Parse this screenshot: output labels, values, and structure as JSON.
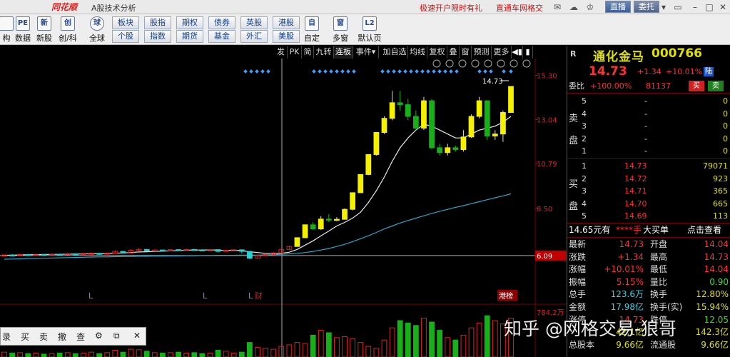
{
  "titlebar": {
    "logo": "同花顺",
    "title": "A股技术分析",
    "promo_1": "极速开户限时有礼",
    "promo_2": "直通车网格交",
    "live": "直播",
    "delegate": "委托"
  },
  "toolbar": {
    "big_left": [
      {
        "icon": "",
        "label": "构"
      },
      {
        "icon": "PE",
        "label": "数据"
      },
      {
        "icon": "新",
        "label": "新股"
      },
      {
        "icon": "创",
        "label": "创/科"
      },
      {
        "icon": "球",
        "label": "全球"
      }
    ],
    "grid_top": [
      "板块",
      "股指",
      "期权",
      "债券",
      "英股",
      "港股"
    ],
    "grid_bottom": [
      "个股",
      "指数",
      "期货",
      "基金",
      "外汇",
      "美股"
    ],
    "big_right": [
      {
        "icon": "自",
        "label": "自定"
      },
      {
        "icon": "窗",
        "label": "多窗"
      },
      {
        "icon": "L2",
        "label": "默认页"
      }
    ]
  },
  "chart_tabs": [
    "发",
    "PK",
    "简",
    "九转",
    "连板",
    "事件",
    "加自选",
    "均线",
    "复权",
    "叠",
    "窗",
    "预测",
    "更多"
  ],
  "chart_data": {
    "type": "candlestick",
    "y_ticks": [
      "15.30",
      "13.04",
      "10.79",
      "8.50",
      "6.09"
    ],
    "peak_label": "14.73",
    "current_line_label": "6.09",
    "bottom_markers": [
      "L",
      "L",
      "L",
      "财",
      "港榜"
    ],
    "indicator_label": "784.2万",
    "candles": [
      {
        "o": 6.1,
        "c": 6.12,
        "h": 6.14,
        "l": 6.06
      },
      {
        "o": 6.12,
        "c": 6.11,
        "h": 6.15,
        "l": 6.08
      },
      {
        "o": 6.11,
        "c": 6.14,
        "h": 6.17,
        "l": 6.09
      },
      {
        "o": 6.14,
        "c": 6.12,
        "h": 6.16,
        "l": 6.1
      },
      {
        "o": 6.12,
        "c": 6.15,
        "h": 6.18,
        "l": 6.1
      },
      {
        "o": 6.15,
        "c": 6.13,
        "h": 6.17,
        "l": 6.11
      },
      {
        "o": 6.13,
        "c": 6.16,
        "h": 6.19,
        "l": 6.12
      },
      {
        "o": 6.16,
        "c": 6.14,
        "h": 6.18,
        "l": 6.12
      },
      {
        "o": 6.14,
        "c": 6.18,
        "h": 6.22,
        "l": 6.13
      },
      {
        "o": 6.18,
        "c": 6.15,
        "h": 6.2,
        "l": 6.14
      },
      {
        "o": 6.15,
        "c": 6.19,
        "h": 6.22,
        "l": 6.14
      },
      {
        "o": 6.19,
        "c": 6.2,
        "h": 6.24,
        "l": 6.17
      },
      {
        "o": 6.2,
        "c": 6.17,
        "h": 6.22,
        "l": 6.15
      },
      {
        "o": 6.17,
        "c": 6.21,
        "h": 6.24,
        "l": 6.16
      },
      {
        "o": 6.21,
        "c": 6.3,
        "h": 6.35,
        "l": 6.2
      },
      {
        "o": 6.3,
        "c": 6.22,
        "h": 6.32,
        "l": 6.2
      },
      {
        "o": 6.22,
        "c": 6.36,
        "h": 6.42,
        "l": 6.21
      },
      {
        "o": 6.36,
        "c": 6.4,
        "h": 6.48,
        "l": 6.34
      },
      {
        "o": 6.4,
        "c": 6.33,
        "h": 6.42,
        "l": 6.3
      },
      {
        "o": 6.33,
        "c": 6.37,
        "h": 6.4,
        "l": 6.31
      },
      {
        "o": 6.37,
        "c": 6.35,
        "h": 6.39,
        "l": 6.33
      },
      {
        "o": 6.35,
        "c": 6.39,
        "h": 6.42,
        "l": 6.33
      },
      {
        "o": 6.39,
        "c": 6.36,
        "h": 6.41,
        "l": 6.34
      },
      {
        "o": 6.36,
        "c": 6.4,
        "h": 6.43,
        "l": 6.35
      },
      {
        "o": 6.4,
        "c": 6.38,
        "h": 6.42,
        "l": 6.36
      },
      {
        "o": 6.38,
        "c": 6.37,
        "h": 6.41,
        "l": 6.35
      },
      {
        "o": 6.37,
        "c": 6.39,
        "h": 6.42,
        "l": 6.35
      },
      {
        "o": 6.39,
        "c": 6.3,
        "h": 6.4,
        "l": 6.25
      },
      {
        "o": 6.3,
        "c": 6.36,
        "h": 6.38,
        "l": 6.28
      },
      {
        "o": 6.36,
        "c": 6.38,
        "h": 6.41,
        "l": 6.34
      },
      {
        "o": 6.38,
        "c": 6.3,
        "h": 6.4,
        "l": 6.2
      },
      {
        "o": 6.3,
        "c": 5.95,
        "h": 6.33,
        "l": 5.9
      },
      {
        "o": 5.95,
        "c": 6.08,
        "h": 6.12,
        "l": 5.93
      },
      {
        "o": 6.08,
        "c": 6.15,
        "h": 6.2,
        "l": 6.06
      },
      {
        "o": 6.15,
        "c": 6.22,
        "h": 6.26,
        "l": 6.13
      },
      {
        "o": 6.22,
        "c": 6.4,
        "h": 6.45,
        "l": 6.2
      },
      {
        "o": 6.4,
        "c": 6.55,
        "h": 6.6,
        "l": 6.38
      },
      {
        "o": 6.55,
        "c": 7.0,
        "h": 7.02,
        "l": 6.54
      },
      {
        "o": 7.0,
        "c": 7.66,
        "h": 7.66,
        "l": 6.98
      },
      {
        "o": 7.66,
        "c": 7.45,
        "h": 7.8,
        "l": 7.4
      },
      {
        "o": 7.45,
        "c": 7.95,
        "h": 8.1,
        "l": 7.4
      },
      {
        "o": 7.95,
        "c": 7.9,
        "h": 8.2,
        "l": 7.8
      },
      {
        "o": 7.9,
        "c": 7.94,
        "h": 8.05,
        "l": 7.85
      },
      {
        "o": 7.94,
        "c": 8.45,
        "h": 8.5,
        "l": 7.92
      },
      {
        "o": 8.45,
        "c": 9.3,
        "h": 9.3,
        "l": 8.4
      },
      {
        "o": 9.3,
        "c": 10.23,
        "h": 10.23,
        "l": 9.28
      },
      {
        "o": 10.23,
        "c": 11.25,
        "h": 11.25,
        "l": 10.2
      },
      {
        "o": 11.25,
        "c": 12.38,
        "h": 12.38,
        "l": 11.2
      },
      {
        "o": 12.38,
        "c": 13.1,
        "h": 13.2,
        "l": 12.3
      },
      {
        "o": 13.1,
        "c": 13.9,
        "h": 14.5,
        "l": 13.0
      },
      {
        "o": 13.9,
        "c": 13.8,
        "h": 14.5,
        "l": 13.5
      },
      {
        "o": 13.8,
        "c": 13.2,
        "h": 14.1,
        "l": 13.0
      },
      {
        "o": 13.2,
        "c": 12.6,
        "h": 13.5,
        "l": 12.5
      },
      {
        "o": 12.6,
        "c": 14.0,
        "h": 14.2,
        "l": 12.5
      },
      {
        "o": 14.0,
        "c": 11.6,
        "h": 14.1,
        "l": 11.5
      },
      {
        "o": 11.6,
        "c": 11.35,
        "h": 11.8,
        "l": 11.2
      },
      {
        "o": 11.35,
        "c": 11.6,
        "h": 11.8,
        "l": 11.2
      },
      {
        "o": 11.6,
        "c": 11.5,
        "h": 11.7,
        "l": 11.4
      },
      {
        "o": 11.5,
        "c": 12.15,
        "h": 12.5,
        "l": 11.4
      },
      {
        "o": 12.15,
        "c": 13.2,
        "h": 13.3,
        "l": 12.1
      },
      {
        "o": 13.2,
        "c": 14.0,
        "h": 14.2,
        "l": 13.1
      },
      {
        "o": 14.0,
        "c": 12.2,
        "h": 14.0,
        "l": 12.0
      },
      {
        "o": 12.2,
        "c": 12.3,
        "h": 12.5,
        "l": 12.0
      },
      {
        "o": 12.3,
        "c": 13.4,
        "h": 13.5,
        "l": 11.9
      },
      {
        "o": 13.4,
        "c": 14.73,
        "h": 14.73,
        "l": 13.4
      }
    ],
    "ma_short": [
      6.1,
      6.11,
      6.12,
      6.13,
      6.13,
      6.14,
      6.15,
      6.15,
      6.16,
      6.16,
      6.17,
      6.18,
      6.18,
      6.19,
      6.21,
      6.22,
      6.24,
      6.27,
      6.28,
      6.3,
      6.31,
      6.33,
      6.34,
      6.36,
      6.37,
      6.37,
      6.38,
      6.36,
      6.35,
      6.36,
      6.34,
      6.28,
      6.24,
      6.2,
      6.18,
      6.2,
      6.26,
      6.4,
      6.62,
      6.84,
      7.1,
      7.34,
      7.6,
      7.78,
      8.0,
      8.3,
      8.8,
      9.4,
      10.1,
      10.9,
      11.6,
      12.1,
      12.5,
      12.8,
      12.7,
      12.5,
      12.3,
      12.1,
      12.1,
      12.3,
      12.5,
      12.6,
      12.7,
      12.9,
      13.2
    ],
    "ma_long": [
      5.9,
      5.91,
      5.92,
      5.93,
      5.94,
      5.95,
      5.96,
      5.97,
      5.98,
      5.99,
      6.0,
      6.01,
      6.02,
      6.02,
      6.03,
      6.04,
      6.04,
      6.05,
      6.05,
      6.06,
      6.06,
      6.07,
      6.07,
      6.08,
      6.08,
      6.09,
      6.09,
      6.1,
      6.1,
      6.1,
      6.11,
      6.11,
      6.11,
      6.12,
      6.13,
      6.15,
      6.17,
      6.2,
      6.24,
      6.3,
      6.37,
      6.45,
      6.55,
      6.66,
      6.8,
      6.95,
      7.1,
      7.27,
      7.45,
      7.6,
      7.75,
      7.88,
      8.0,
      8.12,
      8.24,
      8.35,
      8.45,
      8.55,
      8.64,
      8.74,
      8.84,
      8.94,
      9.04,
      9.14,
      9.24
    ],
    "volume": [
      0.1,
      0.08,
      0.09,
      0.07,
      0.08,
      0.06,
      0.07,
      0.08,
      0.09,
      0.07,
      0.08,
      0.1,
      0.07,
      0.09,
      0.14,
      0.1,
      0.16,
      0.15,
      0.12,
      0.09,
      0.08,
      0.09,
      0.1,
      0.08,
      0.09,
      0.07,
      0.08,
      0.14,
      0.12,
      0.08,
      0.1,
      0.3,
      0.2,
      0.18,
      0.16,
      0.22,
      0.25,
      0.3,
      0.28,
      0.45,
      0.55,
      0.5,
      0.4,
      0.42,
      0.38,
      0.3,
      0.22,
      0.18,
      0.35,
      0.6,
      0.75,
      0.7,
      0.65,
      0.8,
      0.72,
      0.55,
      0.4,
      0.35,
      0.45,
      0.6,
      0.7,
      0.85,
      0.75,
      0.68,
      0.8
    ]
  },
  "quote": {
    "r_label": "R",
    "name": "通化金马",
    "code": "000766",
    "price": "14.73",
    "change": "+1.34",
    "pct": "+10.01%",
    "tag": "陆",
    "weibi_label": "委比",
    "weibi": "+100.00%",
    "weicha": "81137",
    "buy_btn": "买",
    "sell_btn": "卖",
    "sell_side": "卖盘",
    "buy_side": "买盘",
    "asks": [
      {
        "lvl": "5",
        "price": "-",
        "vol": "0"
      },
      {
        "lvl": "4",
        "price": "-",
        "vol": "0"
      },
      {
        "lvl": "3",
        "price": "-",
        "vol": "0"
      },
      {
        "lvl": "2",
        "price": "-",
        "vol": "0"
      },
      {
        "lvl": "1",
        "price": "-",
        "vol": "0"
      }
    ],
    "bids": [
      {
        "lvl": "1",
        "price": "14.73",
        "vol": "79071"
      },
      {
        "lvl": "2",
        "price": "14.72",
        "vol": "923"
      },
      {
        "lvl": "3",
        "price": "14.71",
        "vol": "365"
      },
      {
        "lvl": "4",
        "price": "14.70",
        "vol": "665"
      },
      {
        "lvl": "5",
        "price": "14.69",
        "vol": "113"
      }
    ],
    "summary_1": "14.65元有",
    "summary_2": "****手",
    "summary_3": "大买单",
    "summary_4": "点击查看",
    "stats": [
      {
        "l1": "最新",
        "v1": "14.73",
        "c1": "red",
        "l2": "开盘",
        "v2": "14.04",
        "c2": "red"
      },
      {
        "l1": "涨跌",
        "v1": "+1.34",
        "c1": "red",
        "l2": "最高",
        "v2": "14.73",
        "c2": "red"
      },
      {
        "l1": "涨幅",
        "v1": "+10.01%",
        "c1": "red",
        "l2": "最低",
        "v2": "14.04",
        "c2": "red"
      },
      {
        "l1": "振幅",
        "v1": "5.15%",
        "c1": "red",
        "l2": "量比",
        "v2": "0.90",
        "c2": "green"
      },
      {
        "l1": "总手",
        "v1": "123.6万",
        "c1": "cyan",
        "l2": "换手",
        "v2": "12.80%",
        "c2": "yellow"
      },
      {
        "l1": "金额",
        "v1": "17.98亿",
        "c1": "cyan",
        "l2": "换手(实)",
        "v2": "15.94%",
        "c2": "yellow"
      },
      {
        "l1": "涨停",
        "v1": "14.73",
        "c1": "red",
        "l2": "跌停",
        "v2": "12.05",
        "c2": "green"
      },
      {
        "l1": "",
        "v1": "42.1亿",
        "c1": "yellow",
        "l2": "",
        "v2": "142.3亿",
        "c2": "yellow"
      },
      {
        "l1": "总股本",
        "v1": "9.66亿",
        "c1": "yellow",
        "l2": "流通股",
        "v2": "9.66亿",
        "c2": "yellow"
      }
    ]
  },
  "bottom_strip": [
    "录",
    "买",
    "卖",
    "撤",
    "查"
  ],
  "watermark": "知乎 @网格交易-狼哥"
}
